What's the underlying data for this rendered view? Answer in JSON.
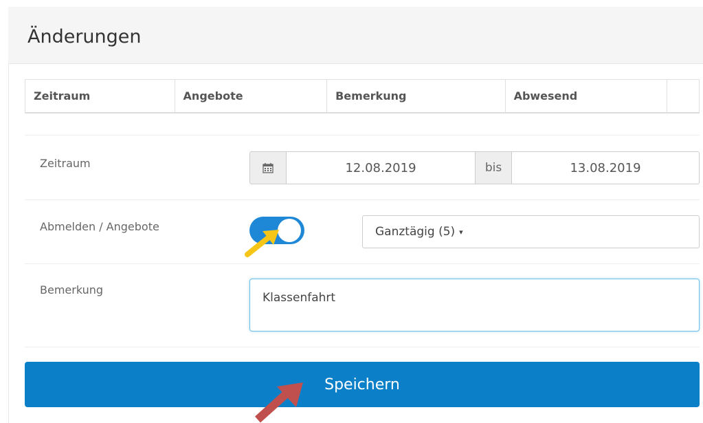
{
  "panel": {
    "title": "Änderungen"
  },
  "table": {
    "headers": [
      "Zeitraum",
      "Angebote",
      "Bemerkung",
      "Abwesend",
      ""
    ]
  },
  "form": {
    "zeitraum": {
      "label": "Zeitraum",
      "icon": "calendar-icon",
      "from": "12.08.2019",
      "separator": "bis",
      "to": "13.08.2019"
    },
    "abmelden": {
      "label": "Abmelden / Angebote",
      "toggle_on": true,
      "select_value": "Ganztägig (5)",
      "caret": "▾"
    },
    "bemerkung": {
      "label": "Bemerkung",
      "value": "Klassenfahrt"
    }
  },
  "actions": {
    "save_label": "Speichern"
  },
  "colors": {
    "primary": "#0b80c8",
    "toggle": "#1e88d6",
    "annotation_yellow": "#f5c518",
    "annotation_red": "#c0504d"
  }
}
